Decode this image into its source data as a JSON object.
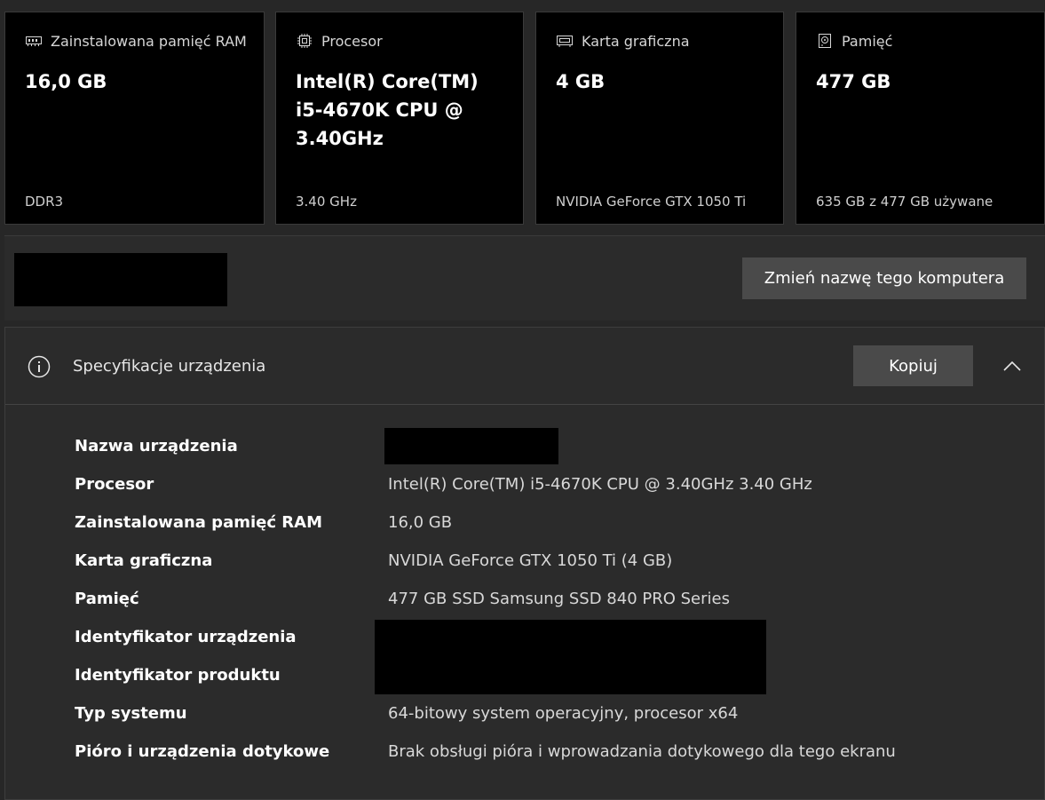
{
  "cards": [
    {
      "label": "Zainstalowana pamięć RAM",
      "value": "16,0 GB",
      "sub": "DDR3",
      "icon": "ram-icon"
    },
    {
      "label": "Procesor",
      "value": "Intel(R) Core(TM) i5-4670K CPU @ 3.40GHz",
      "sub": "3.40 GHz",
      "icon": "cpu-icon"
    },
    {
      "label": "Karta graficzna",
      "value": "4 GB",
      "sub": "NVIDIA GeForce GTX 1050 Ti",
      "icon": "gpu-icon"
    },
    {
      "label": "Pamięć",
      "value": "477 GB",
      "sub": "635 GB z 477 GB używane",
      "icon": "storage-icon"
    }
  ],
  "rename": {
    "button_label": "Zmień nazwę tego komputera"
  },
  "spec": {
    "title": "Specyfikacje urządzenia",
    "copy_label": "Kopiuj",
    "rows": [
      {
        "key": "Nazwa urządzenia",
        "value": ""
      },
      {
        "key": "Procesor",
        "value": "Intel(R) Core(TM) i5-4670K CPU @ 3.40GHz   3.40 GHz"
      },
      {
        "key": "Zainstalowana pamięć RAM",
        "value": "16,0 GB"
      },
      {
        "key": "Karta graficzna",
        "value": "NVIDIA GeForce GTX 1050 Ti (4 GB)"
      },
      {
        "key": "Pamięć",
        "value": "477 GB SSD Samsung SSD 840 PRO Series"
      },
      {
        "key": "Identyfikator urządzenia",
        "value": ""
      },
      {
        "key": "Identyfikator produktu",
        "value": ""
      },
      {
        "key": "Typ systemu",
        "value": "64-bitowy system operacyjny, procesor x64"
      },
      {
        "key": "Pióro i urządzenia dotykowe",
        "value": "Brak obsługi pióra i wprowadzania dotykowego dla tego ekranu"
      }
    ]
  }
}
